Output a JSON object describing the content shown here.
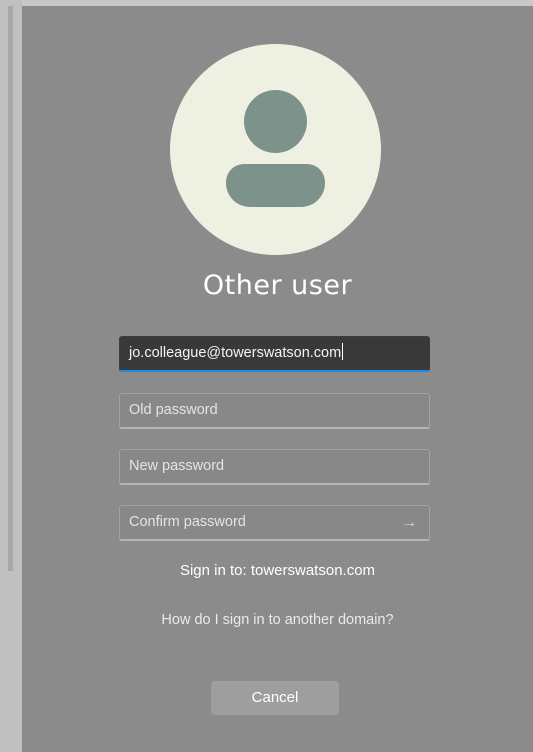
{
  "login": {
    "title": "Other user",
    "username_value": "jo.colleague@towerswatson.com",
    "old_password_placeholder": "Old password",
    "new_password_placeholder": "New password",
    "confirm_password_placeholder": "Confirm password",
    "submit_arrow": "→",
    "sign_in_to": "Sign in to: towerswatson.com",
    "help_link": "How do I sign in to another domain?",
    "cancel_label": "Cancel"
  },
  "icons": {
    "avatar": "user-avatar-icon",
    "submit": "arrow-right-icon"
  },
  "colors": {
    "panel_bg": "#8b8b8b",
    "active_field_bg": "#393939",
    "focus_underline": "#1e88e5",
    "avatar_bg": "#eef1e2",
    "avatar_figure": "#7d928a"
  }
}
